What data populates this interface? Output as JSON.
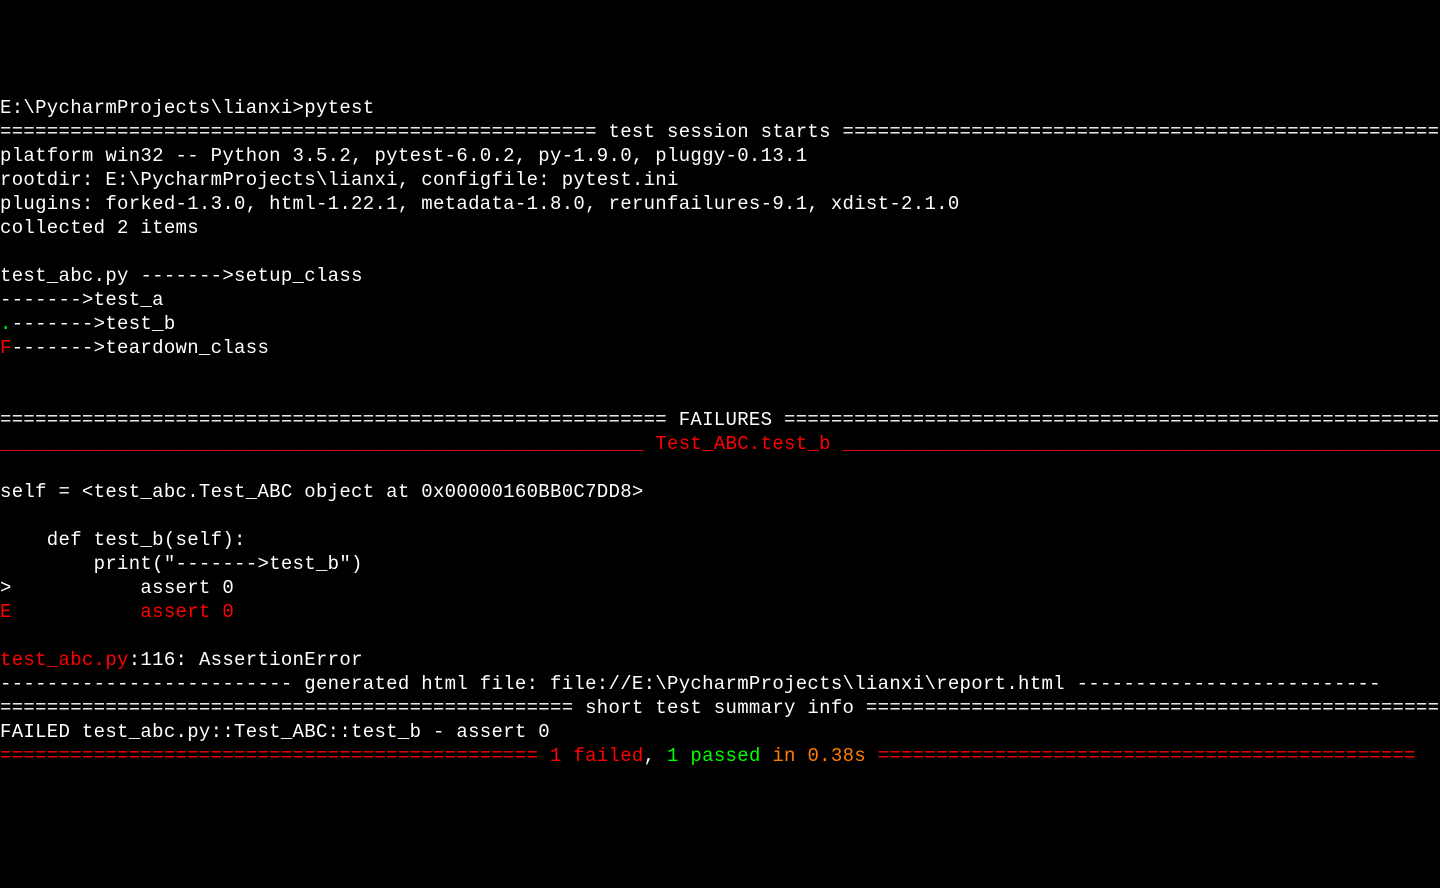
{
  "prompt": "E:\\PycharmProjects\\lianxi>pytest",
  "session_header": "=================================================== test session starts ===================================================",
  "platform_line": "platform win32 -- Python 3.5.2, pytest-6.0.2, py-1.9.0, pluggy-0.13.1",
  "rootdir_line": "rootdir: E:\\PycharmProjects\\lianxi, configfile: pytest.ini",
  "plugins_line": "plugins: forked-1.3.0, html-1.22.1, metadata-1.8.0, rerunfailures-9.1, xdist-2.1.0",
  "collected_line": "collected 2 items",
  "test_file": "test_abc.py ",
  "setup_class": "------->setup_class",
  "test_a_line": "------->test_a",
  "test_b_dot": ".",
  "test_b_line": "------->test_b",
  "teardown_f": "F",
  "teardown_line": "------->teardown_class",
  "failures_header": "========================================================= FAILURES =========================================================",
  "test_name_line_left": "_______________________________________________________ ",
  "test_name": "Test_ABC.test_b",
  "test_name_line_right": " ________________________________________________________",
  "self_line": "self = <test_abc.Test_ABC object at 0x00000160BB0C7DD8>",
  "code_def": "    def test_b(self):",
  "code_print": "        print(\"------->test_b\")",
  "code_assert_prefix": ">",
  "code_assert": "           assert 0",
  "error_e": "E",
  "error_assert": "           assert 0",
  "traceback_file": "test_abc.py",
  "traceback_rest": ":116: AssertionError",
  "html_file_line": "------------------------- generated html file: file://E:\\PycharmProjects\\lianxi\\report.html --------------------------",
  "summary_header": "================================================= short test summary info ==================================================",
  "failed_summary": "FAILED test_abc.py::Test_ABC::test_b - assert 0",
  "result_line_prefix_eq": "============================================== ",
  "result_failed": "1 failed",
  "result_comma": ", ",
  "result_passed": "1 passed",
  "result_time": " in 0.38s",
  "result_line_suffix_eq": " ==============================================",
  "colors": {
    "background": "#000000",
    "foreground": "#ffffff",
    "green": "#00ff00",
    "red": "#ff0000",
    "orange": "#ff7b00"
  }
}
